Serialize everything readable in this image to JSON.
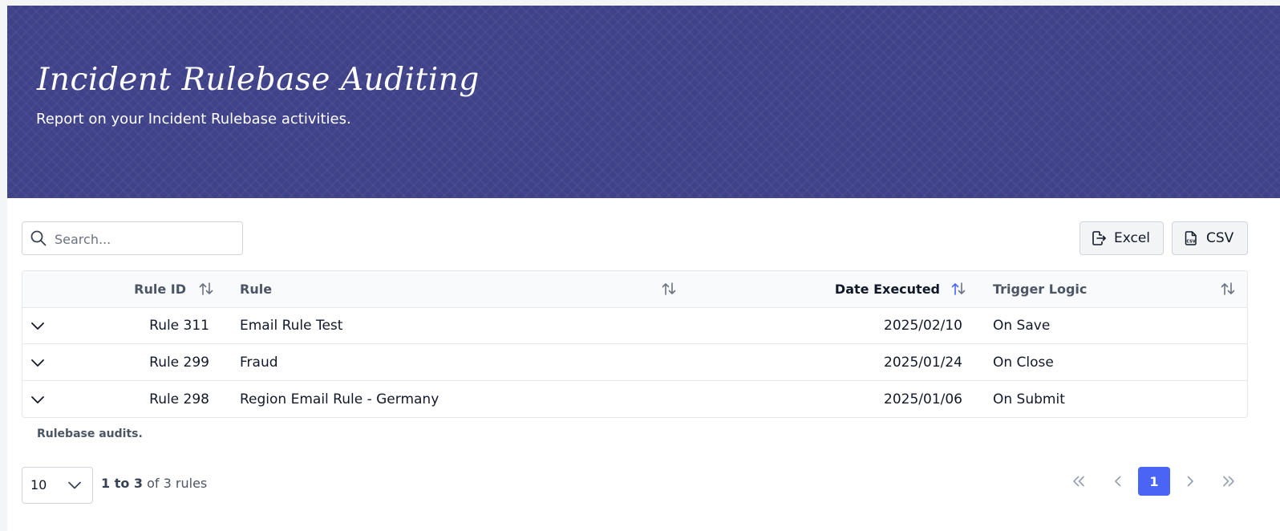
{
  "header": {
    "title": "Incident Rulebase Auditing",
    "subtitle": "Report on your Incident Rulebase activities."
  },
  "toolbar": {
    "search_placeholder": "Search...",
    "excel_label": "Excel",
    "csv_label": "CSV",
    "csv_icon_text": "CSV"
  },
  "table": {
    "columns": {
      "rule_id": "Rule ID",
      "rule": "Rule",
      "date_executed": "Date Executed",
      "trigger_logic": "Trigger Logic"
    },
    "rows": [
      {
        "rule_id": "Rule 311",
        "rule": "Email Rule Test",
        "date": "2025/02/10",
        "trigger": "On Save"
      },
      {
        "rule_id": "Rule 299",
        "rule": "Fraud",
        "date": "2025/01/24",
        "trigger": "On Close"
      },
      {
        "rule_id": "Rule 298",
        "rule": "Region Email Rule - Germany",
        "date": "2025/01/06",
        "trigger": "On Submit"
      }
    ],
    "caption": "Rulebase audits."
  },
  "pagination": {
    "page_size": "10",
    "range": "1 to 3",
    "total_text": "of 3 rules",
    "current_page": "1"
  },
  "colors": {
    "header_bg": "#3f4289",
    "accent": "#4a64f5"
  }
}
